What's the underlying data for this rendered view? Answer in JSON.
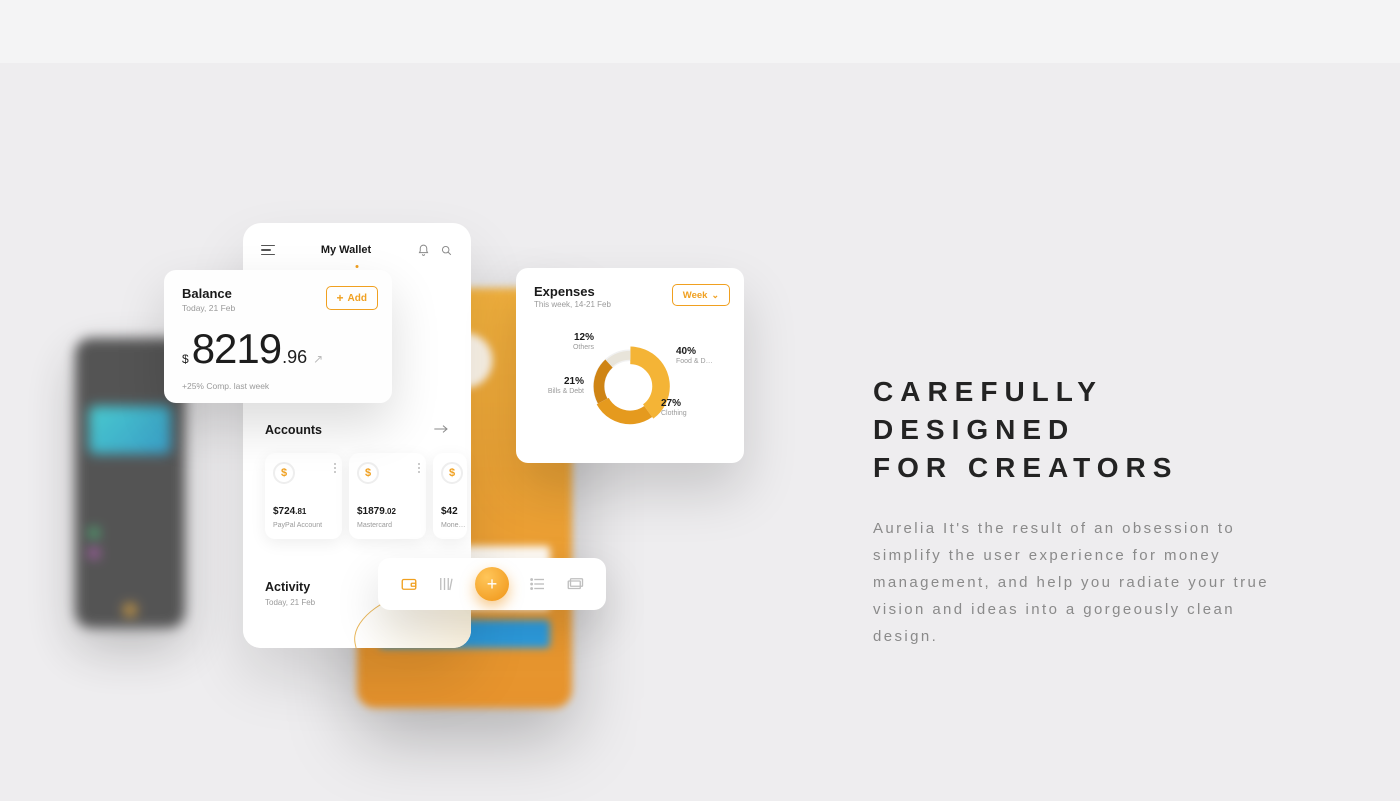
{
  "marketing": {
    "heading_line1": "CAREFULLY DESIGNED",
    "heading_line2": "FOR CREATORS",
    "paragraph": "Aurelia It's the result of an obsession to simplify the user experience for money management, and help you radiate your true vision and ideas into a gorgeously clean design."
  },
  "screen_main": {
    "title": "My Wallet",
    "accounts": {
      "heading": "Accounts",
      "cards": [
        {
          "amount_whole": "$724",
          "amount_dec": ".81",
          "label": "PayPal Account"
        },
        {
          "amount_whole": "$1879",
          "amount_dec": ".02",
          "label": "Mastercard"
        },
        {
          "amount_whole": "$42",
          "amount_dec": "",
          "label": "Mone…"
        }
      ]
    },
    "activity": {
      "heading": "Activity",
      "date": "Today, 21 Feb"
    }
  },
  "card_balance": {
    "heading": "Balance",
    "date": "Today, 21 Feb",
    "add_label": "Add",
    "currency": "$",
    "whole": "8219",
    "decimals": ".96",
    "note": "+25% Comp. last week"
  },
  "card_expenses": {
    "heading": "Expenses",
    "date": "This week, 14-21 Feb",
    "period_label": "Week",
    "segments": {
      "others": {
        "pct": "12%",
        "label": "Others"
      },
      "bills": {
        "pct": "21%",
        "label": "Bills & Debt"
      },
      "food": {
        "pct": "40%",
        "label": "Food & D…"
      },
      "clothing": {
        "pct": "27%",
        "label": "Clothing"
      }
    }
  },
  "chart_data": {
    "type": "pie",
    "title": "Expenses",
    "categories": [
      "Food & D…",
      "Clothing",
      "Bills & Debt",
      "Others"
    ],
    "values": [
      40,
      27,
      21,
      12
    ]
  }
}
